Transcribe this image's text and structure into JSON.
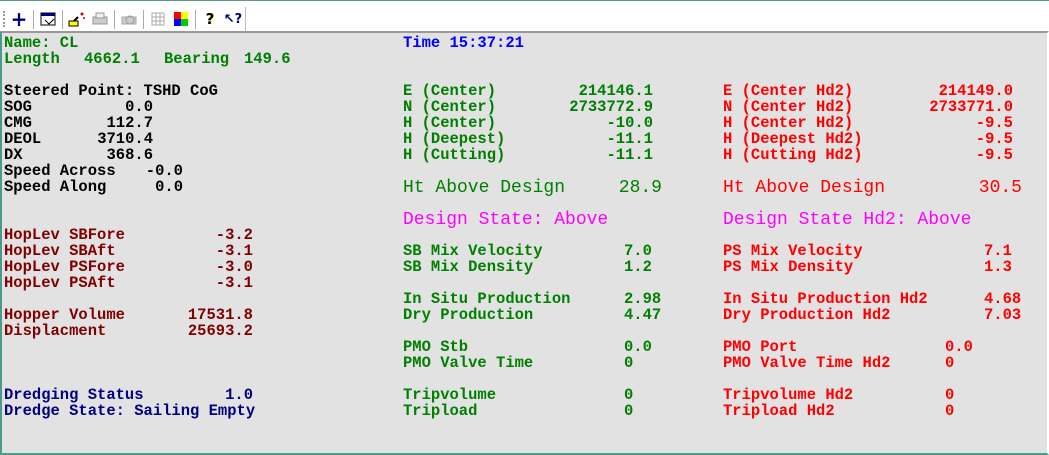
{
  "toolbar": {
    "icons": [
      "add-icon",
      "properties-icon",
      "wizard-icon",
      "print-icon",
      "print-preview-icon",
      "grid-icon",
      "color-palette-icon",
      "help-icon",
      "context-help-icon"
    ]
  },
  "colors": {
    "green": "#008000",
    "red": "#ff0000",
    "magenta": "#ff00ff",
    "dark_red": "#800000",
    "navy": "#000080",
    "background": "#e2e2e2"
  },
  "header": {
    "name": "Name: CL",
    "length_label": "Length",
    "length": "4662.1",
    "bearing_label": "Bearing",
    "bearing": "149.6",
    "time": "Time 15:37:21"
  },
  "nav": {
    "steered_point": "Steered Point: TSHD CoG",
    "rows": [
      {
        "label": "SOG",
        "value": "0.0"
      },
      {
        "label": "CMG",
        "value": "112.7"
      },
      {
        "label": "DEOL",
        "value": "3710.4"
      },
      {
        "label": "DX",
        "value": "368.6"
      },
      {
        "label": "Speed Across",
        "value": "-0.0"
      },
      {
        "label": "Speed Along",
        "value": "0.0"
      }
    ]
  },
  "hopper": {
    "levels": [
      {
        "label": "HopLev SBFore",
        "value": "-3.2"
      },
      {
        "label": "HopLev SBAft",
        "value": "-3.1"
      },
      {
        "label": "HopLev PSFore",
        "value": "-3.0"
      },
      {
        "label": "HopLev PSAft",
        "value": "-3.1"
      }
    ],
    "volume": {
      "label": "Hopper Volume",
      "value": "17531.8"
    },
    "displacement": {
      "label": "Displacment",
      "value": "25693.2"
    }
  },
  "dredging": {
    "status_label": "Dredging Status",
    "status": "1.0",
    "state": "Dredge State: Sailing Empty"
  },
  "head1": {
    "coords": [
      {
        "label": "E (Center)",
        "value": "214146.1"
      },
      {
        "label": "N (Center)",
        "value": "2733772.9"
      },
      {
        "label": "H (Center)",
        "value": "-10.0"
      },
      {
        "label": "H (Deepest)",
        "value": "-11.1"
      },
      {
        "label": "H (Cutting)",
        "value": "-11.1"
      }
    ],
    "ht_label": "Ht Above Design",
    "ht": "28.9",
    "design_state": "Design State: Above",
    "rows": [
      {
        "label": "SB Mix Velocity",
        "value": "7.0"
      },
      {
        "label": "SB Mix Density",
        "value": "1.2"
      },
      {
        "label": "In Situ Production",
        "value": "2.98"
      },
      {
        "label": "Dry Production",
        "value": "4.47"
      },
      {
        "label": "PMO Stb",
        "value": "0.0"
      },
      {
        "label": "PMO Valve Time",
        "value": "0"
      },
      {
        "label": "Tripvolume",
        "value": "0"
      },
      {
        "label": "Tripload",
        "value": "0"
      }
    ]
  },
  "head2": {
    "coords": [
      {
        "label": "E (Center Hd2)",
        "value": "214149.0"
      },
      {
        "label": "N (Center Hd2)",
        "value": "2733771.0"
      },
      {
        "label": "H (Center Hd2)",
        "value": "-9.5"
      },
      {
        "label": "H (Deepest Hd2)",
        "value": "-9.5"
      },
      {
        "label": "H (Cutting Hd2)",
        "value": "-9.5"
      }
    ],
    "ht_label": "Ht Above Design",
    "ht": "30.5",
    "design_state": "Design State Hd2: Above",
    "rows": [
      {
        "label": "PS Mix Velocity",
        "value": "7.1"
      },
      {
        "label": "PS Mix Density",
        "value": "1.3"
      },
      {
        "label": "In Situ Production Hd2",
        "value": "4.68"
      },
      {
        "label": "Dry Production Hd2",
        "value": "7.03"
      },
      {
        "label": "PMO Port",
        "value": "0.0"
      },
      {
        "label": "PMO Valve Time Hd2",
        "value": "0"
      },
      {
        "label": "Tripvolume Hd2",
        "value": "0"
      },
      {
        "label": "Tripload Hd2",
        "value": "0"
      }
    ]
  }
}
